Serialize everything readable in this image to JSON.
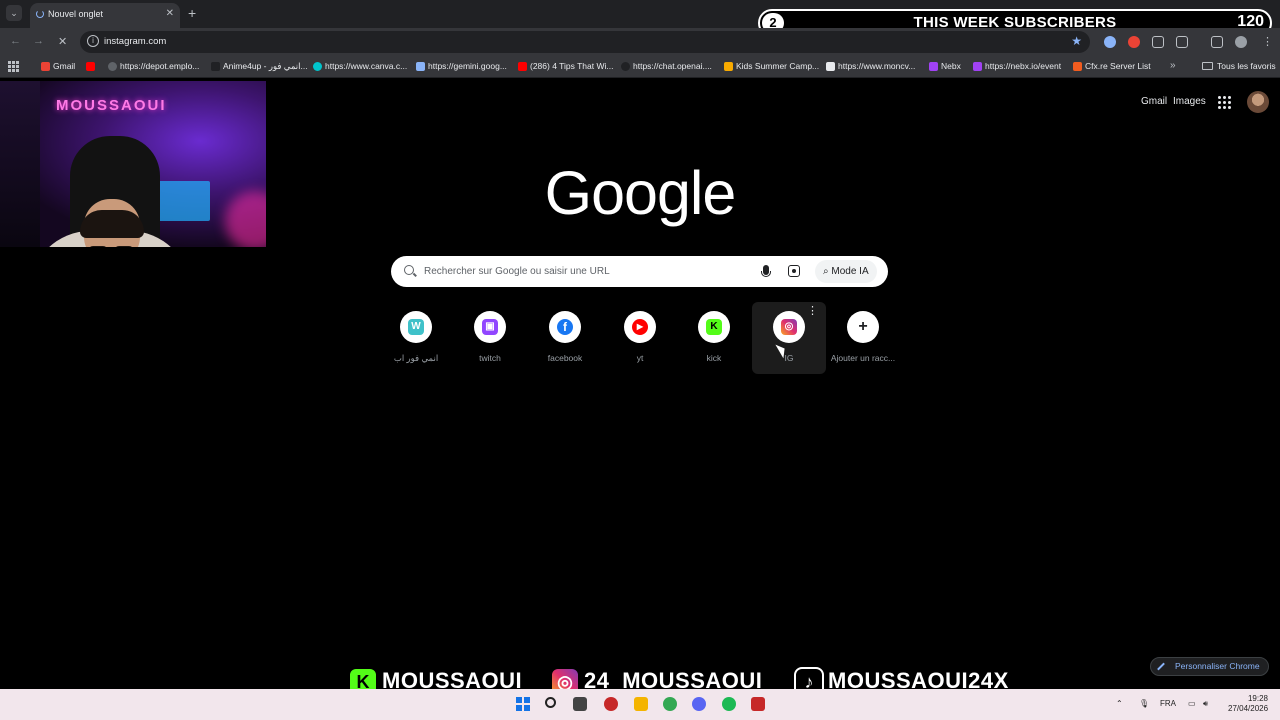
{
  "browser": {
    "tab_title": "Nouvel onglet",
    "tab_close": "✕",
    "new_tab": "+",
    "url": "instagram.com",
    "bookmarks": [
      {
        "label": "Gmail",
        "color": "#ea4335"
      },
      {
        "label": "",
        "color": "#ff0000"
      },
      {
        "label": "https://depot.emplo...",
        "color": "#5f6368"
      },
      {
        "label": "Anime4up - انمي فور...",
        "color": "#202124"
      },
      {
        "label": "https://www.canva.c...",
        "color": "#00c4cc"
      },
      {
        "label": "https://gemini.goog...",
        "color": "#8ab4f8"
      },
      {
        "label": "(286) 4 Tips That Wi...",
        "color": "#ff0000"
      },
      {
        "label": "https://chat.openai....",
        "color": "#202124"
      },
      {
        "label": "Kids Summer Camp...",
        "color": "#f9ab00"
      },
      {
        "label": "https://www.moncv...",
        "color": "#e8eaed"
      },
      {
        "label": "Nebx",
        "color": "#a142f4"
      },
      {
        "label": "https://nebx.io/event",
        "color": "#a142f4"
      },
      {
        "label": "Cfx.re Server List",
        "color": "#f25c1f"
      }
    ],
    "bookmarks_more": "»",
    "all_bookmarks": "Tous les favoris"
  },
  "overlay": {
    "subs_left": "2",
    "subs_title": "THIS WEEK SUBSCRIBERS",
    "subs_count": "120",
    "webcam_sign": "MOUSSAOUI",
    "socials": [
      {
        "platform": "kick",
        "icon": "K",
        "handle": "MOUSSAOUI",
        "color": "#53fc18"
      },
      {
        "platform": "instagram",
        "icon": "◎",
        "handle": "24_MOUSSAOUI",
        "color": "#e1306c"
      },
      {
        "platform": "tiktok",
        "icon": "♪",
        "handle": "MOUSSAOUI24X",
        "color": "#000000"
      }
    ]
  },
  "google": {
    "top_links": {
      "gmail": "Gmail",
      "images": "Images"
    },
    "logo": "Google",
    "search_placeholder": "Rechercher sur Google ou saisir une URL",
    "mode_ia": "Mode IA",
    "shortcuts": [
      {
        "label": "انمي فور اب",
        "icon": "W",
        "color": "#3fc1c9"
      },
      {
        "label": "twitch",
        "icon": "▣",
        "color": "#9146ff"
      },
      {
        "label": "facebook",
        "icon": "f",
        "color": "#1877f2"
      },
      {
        "label": "yt",
        "icon": "▶",
        "color": "#ff0000"
      },
      {
        "label": "kick",
        "icon": "K",
        "color": "#53fc18"
      },
      {
        "label": "IG",
        "icon": "◎",
        "color": "#e1306c"
      },
      {
        "label": "Ajouter un racc...",
        "icon": "+",
        "color": "#202124"
      }
    ],
    "shortcut_more": "⋮",
    "customize": "Personnaliser Chrome"
  },
  "taskbar": {
    "lang": "FRA",
    "time": "19:28",
    "date": "27/04/2026",
    "apps": [
      {
        "name": "file-explorer-icon",
        "color": "#f4b400"
      },
      {
        "name": "chrome-icon",
        "color": "#34a853"
      },
      {
        "name": "discord-icon",
        "color": "#5865f2"
      },
      {
        "name": "spotify-icon",
        "color": "#1db954"
      },
      {
        "name": "game-icon",
        "color": "#c62828"
      }
    ]
  }
}
